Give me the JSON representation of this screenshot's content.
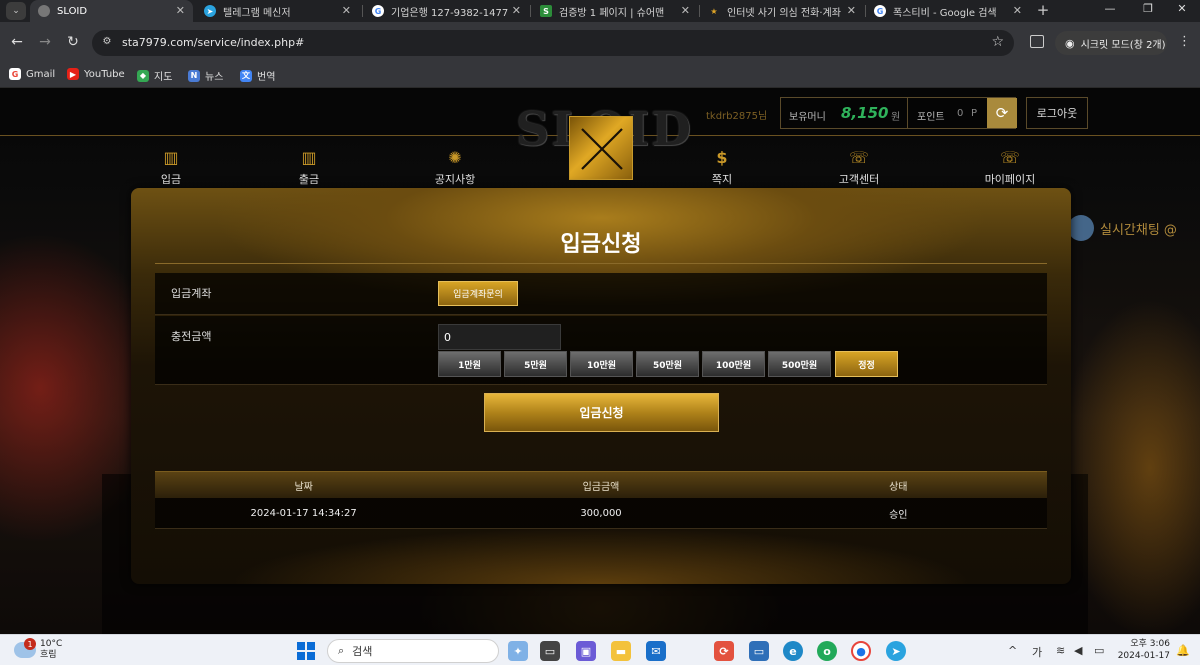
{
  "browser": {
    "tabs": [
      {
        "title": "SLOID",
        "active": true,
        "icon": "globe-icon"
      },
      {
        "title": "텔레그램 메신저",
        "active": false,
        "icon": "telegram-icon"
      },
      {
        "title": "기업은행 127-9382-1477",
        "active": false,
        "icon": "google-icon"
      },
      {
        "title": "검증방 1 페이지 | 슈어맨",
        "active": false,
        "icon": "sureman-icon"
      },
      {
        "title": "인터넷 사기 의심 전화·계좌",
        "active": false,
        "icon": "police-icon"
      },
      {
        "title": "폭스티비 - Google 검색",
        "active": false,
        "icon": "google-icon"
      }
    ],
    "url": "sta7979.com/service/index.php#",
    "incognito_label": "시크릿 모드(창 2개)",
    "bookmarks": [
      {
        "label": "Gmail",
        "icon": "google-icon"
      },
      {
        "label": "YouTube",
        "icon": "youtube-icon"
      },
      {
        "label": "지도",
        "icon": "maps-icon"
      },
      {
        "label": "뉴스",
        "icon": "news-icon"
      },
      {
        "label": "번역",
        "icon": "translate-icon"
      }
    ]
  },
  "site": {
    "logo_text": "SLOID",
    "username": "tkdrb2875님",
    "balance_label": "보유머니",
    "balance_value": "8,150",
    "balance_unit": "원",
    "points_label": "포인트",
    "points_value": "0",
    "points_unit": "P",
    "logout_label": "로그아웃",
    "nav": [
      {
        "label": "입금",
        "icon": "deposit-icon"
      },
      {
        "label": "출금",
        "icon": "withdraw-icon"
      },
      {
        "label": "공지사항",
        "icon": "notice-icon"
      },
      {
        "label": "쪽지",
        "icon": "message-icon"
      },
      {
        "label": "고객센터",
        "icon": "support-icon"
      },
      {
        "label": "마이페이지",
        "icon": "mypage-icon"
      }
    ],
    "live_chat_label": "실시간채팅 @"
  },
  "deposit": {
    "title": "입금신청",
    "account_label": "입금계좌",
    "account_inquiry_button": "입금계좌문의",
    "amount_label": "충전금액",
    "amount_value": "0",
    "amount_buttons": [
      "1만원",
      "5만원",
      "10만원",
      "50만원",
      "100만원",
      "500만원"
    ],
    "reset_button": "정정",
    "submit_button": "입금신청"
  },
  "history": {
    "columns": [
      "날짜",
      "입금금액",
      "상태"
    ],
    "rows": [
      [
        "2024-01-17 14:34:27",
        "300,000",
        "승인"
      ]
    ]
  },
  "taskbar": {
    "weather_temp": "10°C",
    "weather_desc": "흐림",
    "weather_badge": "1",
    "search_placeholder": "검색",
    "ime_label": "가",
    "time": "오후 3:06",
    "date": "2024-01-17"
  },
  "colors": {
    "gold_accent": "#c99828",
    "balance_green": "#2fb35b",
    "panel_dark": "#140e05"
  }
}
